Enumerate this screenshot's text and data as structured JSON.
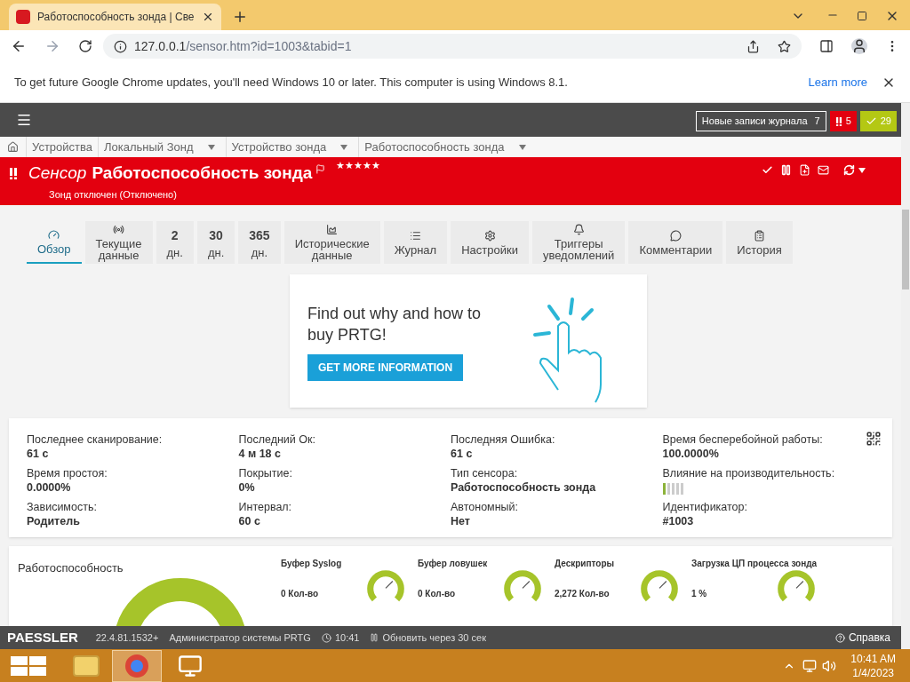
{
  "browser": {
    "tab_title": "Работоспособность зонда | Све",
    "url_host": "127.0.0.1",
    "url_path": "/sensor.htm?id=1003&tabid=1",
    "infobar": {
      "message": "To get future Google Chrome updates, you'll need Windows 10 or later. This computer is using Windows 8.1.",
      "link": "Learn more"
    }
  },
  "topbar": {
    "log_label": "Новые записи журнала",
    "log_count": "7",
    "alarms": "5",
    "ok": "29"
  },
  "breadcrumbs": [
    {
      "label": "Устройства",
      "dropdown": false
    },
    {
      "label": "Локальный Зонд",
      "dropdown": true
    },
    {
      "label": "Устройство зонда",
      "dropdown": true
    },
    {
      "label": "Работоспособность зонда",
      "dropdown": true
    }
  ],
  "header": {
    "prefix": "Сенсор",
    "name": "Работоспособность зонда",
    "stars": 5,
    "status": "Зонд отключен (Отключено)"
  },
  "tabs": [
    {
      "kind": "icon",
      "lines": [
        "Обзор"
      ],
      "selected": true
    },
    {
      "kind": "icon",
      "lines": [
        "Текущие",
        "данные"
      ],
      "selected": false
    },
    {
      "kind": "days",
      "lines": [
        "2",
        "дн."
      ],
      "selected": false
    },
    {
      "kind": "days",
      "lines": [
        "30",
        "дн."
      ],
      "selected": false
    },
    {
      "kind": "days",
      "lines": [
        "365",
        "дн."
      ],
      "selected": false
    },
    {
      "kind": "icon",
      "lines": [
        "Исторические",
        "данные"
      ],
      "selected": false
    },
    {
      "kind": "icon",
      "lines": [
        "Журнал"
      ],
      "selected": false
    },
    {
      "kind": "icon",
      "lines": [
        "Настройки"
      ],
      "selected": false
    },
    {
      "kind": "icon",
      "lines": [
        "Триггеры",
        "уведомлений"
      ],
      "selected": false
    },
    {
      "kind": "icon",
      "lines": [
        "Комментарии"
      ],
      "selected": false
    },
    {
      "kind": "icon",
      "lines": [
        "История"
      ],
      "selected": false
    }
  ],
  "promo": {
    "text": "Find out why and how to buy PRTG!",
    "button": "GET MORE INFORMATION"
  },
  "details": [
    {
      "kind": "text",
      "label": "Последнее сканирование:",
      "value": "61 с"
    },
    {
      "kind": "text",
      "label": "Последний Ок:",
      "value": "4 м 18 с"
    },
    {
      "kind": "text",
      "label": "Последняя Ошибка:",
      "value": "61 с"
    },
    {
      "kind": "text",
      "label": "Время бесперебойной работы:",
      "value": "100.0000%"
    },
    {
      "kind": "text",
      "label": "Время простоя:",
      "value": "0.0000%"
    },
    {
      "kind": "text",
      "label": "Покрытие:",
      "value": "0%"
    },
    {
      "kind": "text",
      "label": "Тип сенсора:",
      "value": "Работоспособность зонда"
    },
    {
      "kind": "meter",
      "label": "Влияние на производительность:",
      "level": 0.2
    },
    {
      "kind": "text",
      "label": "Зависимость:",
      "value": "Родитель"
    },
    {
      "kind": "text",
      "label": "Интервал:",
      "value": "60 с"
    },
    {
      "kind": "text",
      "label": "Автономный:",
      "value": "Нет"
    },
    {
      "kind": "text",
      "label": "Идентификатор:",
      "value": "#1003"
    }
  ],
  "channels": {
    "title": "Работоспособность",
    "gauges": [
      {
        "name": "Буфер Syslog",
        "value": "0 Кол-во"
      },
      {
        "name": "Буфер ловушек",
        "value": "0 Кол-во"
      },
      {
        "name": "Дескрипторы",
        "value": "2,272 Кол-во"
      },
      {
        "name": "Загрузка ЦП процесса зонда",
        "value": "1 %"
      }
    ]
  },
  "footer": {
    "brand": "PAESSLER",
    "version": "22.4.81.1532+",
    "user": "Администратор системы PRTG",
    "time": "10:41",
    "refresh": "Обновить через 30 сек",
    "help": "Справка"
  },
  "taskbar": {
    "time": "10:41 AM",
    "date": "1/4/2023"
  }
}
